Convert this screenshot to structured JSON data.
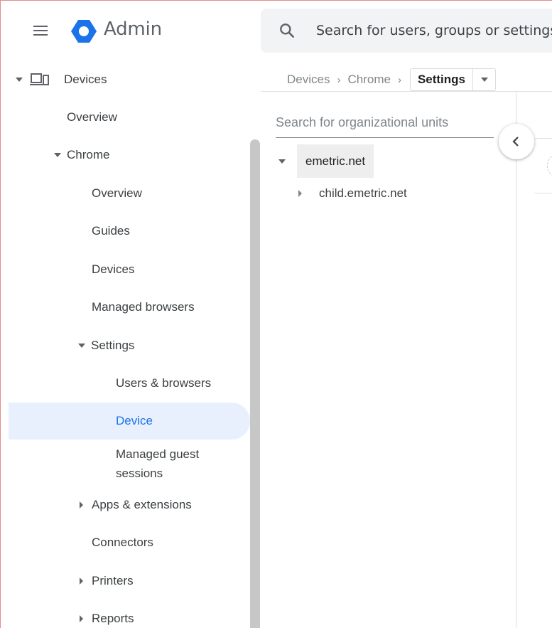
{
  "header": {
    "brand": "Admin",
    "search_placeholder": "Search for users, groups or settings"
  },
  "sidebar": {
    "items": [
      {
        "label": "Devices",
        "expanded": true
      },
      {
        "label": "Overview"
      },
      {
        "label": "Chrome",
        "expanded": true
      },
      {
        "label": "Overview"
      },
      {
        "label": "Guides"
      },
      {
        "label": "Devices"
      },
      {
        "label": "Managed browsers"
      },
      {
        "label": "Settings",
        "expanded": true
      },
      {
        "label": "Users & browsers"
      },
      {
        "label": "Device",
        "selected": true
      },
      {
        "label": "Managed guest sessions",
        "line1": "Managed guest",
        "line2": "sessions"
      },
      {
        "label": "Apps & extensions",
        "expanded": false
      },
      {
        "label": "Connectors"
      },
      {
        "label": "Printers",
        "expanded": false
      },
      {
        "label": "Reports",
        "expanded": false
      }
    ]
  },
  "breadcrumb": {
    "items": [
      "Devices",
      "Chrome"
    ],
    "current": "Settings"
  },
  "org_units": {
    "search_placeholder": "Search for organizational units",
    "root": "emetric.net",
    "children": [
      "child.emetric.net"
    ]
  },
  "colors": {
    "accent": "#1a73e8",
    "selected_bg": "#e8f0fe",
    "logo_blue": "#1a73e8"
  }
}
